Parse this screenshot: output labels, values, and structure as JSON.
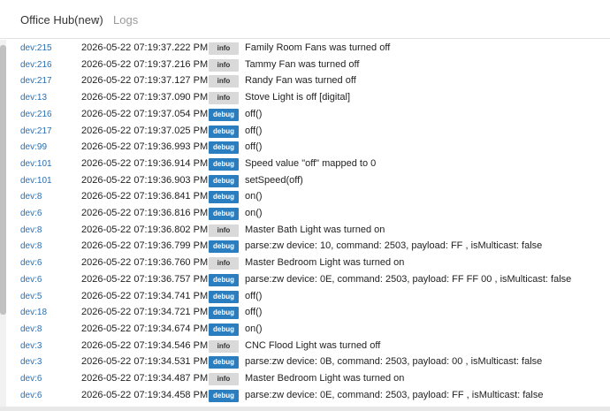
{
  "breadcrumb": {
    "home": "Office Hub(new)",
    "separator": "›",
    "current": "Logs"
  },
  "logs": [
    {
      "dev": "dev:215",
      "time": "2026-05-22 07:19:37.222 PM",
      "level": "info",
      "msg": "Family Room Fans was turned off"
    },
    {
      "dev": "dev:216",
      "time": "2026-05-22 07:19:37.216 PM",
      "level": "info",
      "msg": "Tammy Fan was turned off"
    },
    {
      "dev": "dev:217",
      "time": "2026-05-22 07:19:37.127 PM",
      "level": "info",
      "msg": "Randy Fan was turned off"
    },
    {
      "dev": "dev:13",
      "time": "2026-05-22 07:19:37.090 PM",
      "level": "info",
      "msg": "Stove Light is off [digital]"
    },
    {
      "dev": "dev:216",
      "time": "2026-05-22 07:19:37.054 PM",
      "level": "debug",
      "msg": "off()"
    },
    {
      "dev": "dev:217",
      "time": "2026-05-22 07:19:37.025 PM",
      "level": "debug",
      "msg": "off()"
    },
    {
      "dev": "dev:99",
      "time": "2026-05-22 07:19:36.993 PM",
      "level": "debug",
      "msg": "off()"
    },
    {
      "dev": "dev:101",
      "time": "2026-05-22 07:19:36.914 PM",
      "level": "debug",
      "msg": "Speed value \"off\" mapped to 0"
    },
    {
      "dev": "dev:101",
      "time": "2026-05-22 07:19:36.903 PM",
      "level": "debug",
      "msg": "setSpeed(off)"
    },
    {
      "dev": "dev:8",
      "time": "2026-05-22 07:19:36.841 PM",
      "level": "debug",
      "msg": "on()"
    },
    {
      "dev": "dev:6",
      "time": "2026-05-22 07:19:36.816 PM",
      "level": "debug",
      "msg": "on()"
    },
    {
      "dev": "dev:8",
      "time": "2026-05-22 07:19:36.802 PM",
      "level": "info",
      "msg": "Master Bath Light was turned on"
    },
    {
      "dev": "dev:8",
      "time": "2026-05-22 07:19:36.799 PM",
      "level": "debug",
      "msg": "parse:zw device: 10, command: 2503, payload: FF , isMulticast: false"
    },
    {
      "dev": "dev:6",
      "time": "2026-05-22 07:19:36.760 PM",
      "level": "info",
      "msg": "Master Bedroom Light was turned on"
    },
    {
      "dev": "dev:6",
      "time": "2026-05-22 07:19:36.757 PM",
      "level": "debug",
      "msg": "parse:zw device: 0E, command: 2503, payload: FF FF 00 , isMulticast: false"
    },
    {
      "dev": "dev:5",
      "time": "2026-05-22 07:19:34.741 PM",
      "level": "debug",
      "msg": "off()"
    },
    {
      "dev": "dev:18",
      "time": "2026-05-22 07:19:34.721 PM",
      "level": "debug",
      "msg": "off()"
    },
    {
      "dev": "dev:8",
      "time": "2026-05-22 07:19:34.674 PM",
      "level": "debug",
      "msg": "on()"
    },
    {
      "dev": "dev:3",
      "time": "2026-05-22 07:19:34.546 PM",
      "level": "info",
      "msg": "CNC Flood Light was turned off"
    },
    {
      "dev": "dev:3",
      "time": "2026-05-22 07:19:34.531 PM",
      "level": "debug",
      "msg": "parse:zw device: 0B, command: 2503, payload: 00 , isMulticast: false"
    },
    {
      "dev": "dev:6",
      "time": "2026-05-22 07:19:34.487 PM",
      "level": "info",
      "msg": "Master Bedroom Light was turned on"
    },
    {
      "dev": "dev:6",
      "time": "2026-05-22 07:19:34.458 PM",
      "level": "debug",
      "msg": "parse:zw device: 0E, command: 2503, payload: FF , isMulticast: false"
    }
  ]
}
